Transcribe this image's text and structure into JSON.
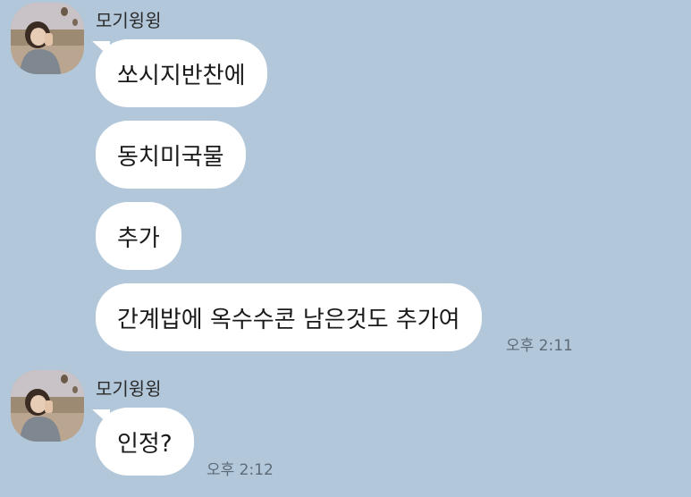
{
  "colors": {
    "background": "#b2c7da",
    "bubble": "#ffffff",
    "time_text": "#5d6b78"
  },
  "groups": [
    {
      "sender": "모기윙윙",
      "avatar_icon": "profile-photo-avatar",
      "messages": [
        "쏘시지반찬에",
        "동치미국물",
        "추가",
        "간계밥에 옥수수콘 남은것도 추가여"
      ],
      "time": "오후 2:11"
    },
    {
      "sender": "모기윙윙",
      "avatar_icon": "profile-photo-avatar",
      "messages": [
        "인정?"
      ],
      "time": "오후 2:12"
    }
  ]
}
